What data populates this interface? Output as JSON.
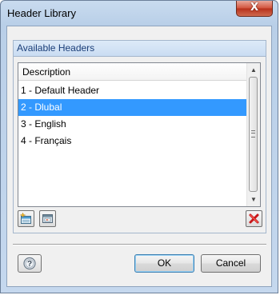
{
  "window": {
    "title": "Header Library",
    "close_glyph": "X"
  },
  "group": {
    "title": "Available Headers"
  },
  "list": {
    "column_header": "Description",
    "rows": [
      {
        "label": "1 - Default Header",
        "selected": false
      },
      {
        "label": "2 - Dlubal",
        "selected": true
      },
      {
        "label": "3 - English",
        "selected": false
      },
      {
        "label": "4 - Français",
        "selected": false
      }
    ],
    "selected_color": "#3399ff"
  },
  "toolbar": {
    "icons": [
      "new-header-icon",
      "import-header-icon",
      "delete-icon"
    ]
  },
  "buttons": {
    "help_icon": "help-icon",
    "ok_label": "OK",
    "cancel_label": "Cancel"
  }
}
